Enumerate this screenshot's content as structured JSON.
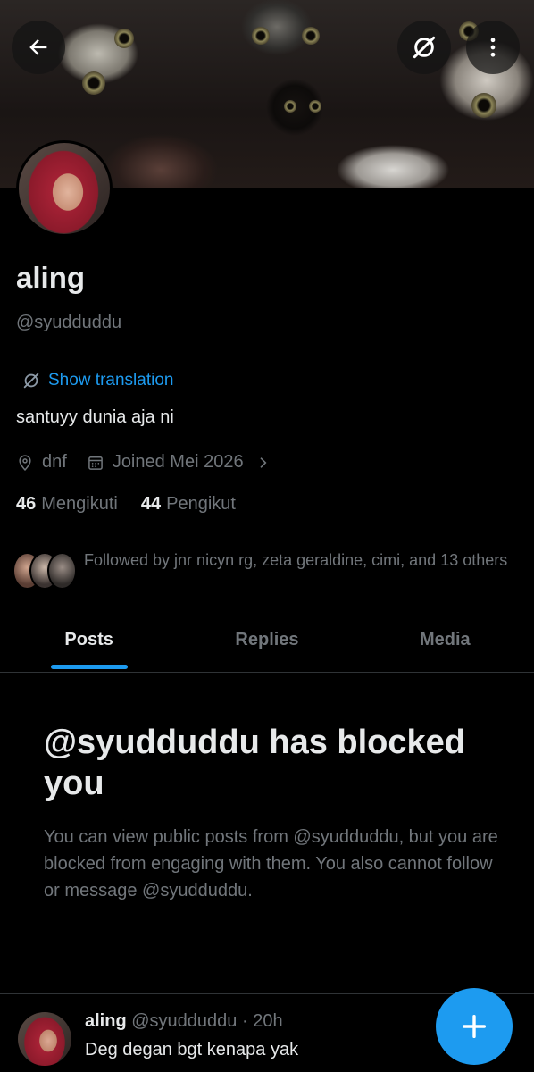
{
  "profile": {
    "name": "aling",
    "handle": "@syudduddu",
    "translation_label": "Show translation",
    "bio": "santuyy dunia aja ni",
    "location": "dnf",
    "joined": "Joined Mei 2026",
    "following_count": "46",
    "following_label": "Mengikuti",
    "followers_count": "44",
    "followers_label": "Pengikut",
    "followed_by": "Followed by jnr nicyn rg, zeta geraldine, cimi, and 13 others"
  },
  "tabs": [
    {
      "label": "Posts",
      "active": true
    },
    {
      "label": "Replies",
      "active": false
    },
    {
      "label": "Media",
      "active": false
    }
  ],
  "blocked": {
    "title": "@syudduddu has blocked you",
    "body": "You can view public posts from @syudduddu, but you are blocked from engaging with them. You also cannot follow or message @syudduddu."
  },
  "post": {
    "name": "aling",
    "handle": "@syudduddu",
    "separator": "·",
    "time": "20h",
    "text": "Deg degan bgt kenapa yak"
  },
  "icons": {
    "back": "arrow-left-icon",
    "translate": "grok-translate-icon",
    "more": "more-vertical-icon",
    "location": "location-pin-icon",
    "calendar": "calendar-icon",
    "chevron": "chevron-right-icon",
    "compose": "plus-icon"
  },
  "colors": {
    "accent": "#1d9bf0",
    "background": "#000000",
    "text": "#e7e9ea",
    "muted": "#71767b"
  }
}
